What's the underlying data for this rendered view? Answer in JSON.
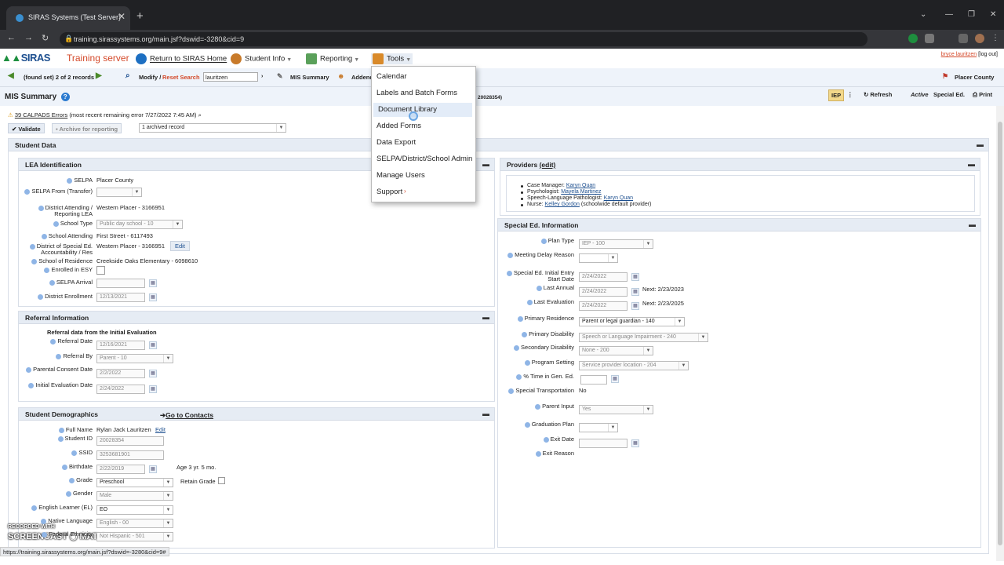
{
  "browser": {
    "tab_title": "SIRAS Systems (Test Server)",
    "url": "training.sirassystems.org/main.jsf?dswid=-3280&cid=9"
  },
  "app": {
    "logo": "SIRAS",
    "server": "Training server",
    "return_link": "Return to SIRAS Home",
    "nav": [
      "Student Info",
      "Reporting",
      "Tools"
    ],
    "user": "bryce lauritzen",
    "logout": "[log out]"
  },
  "toolbar": {
    "found_set": "(found set) 2 of 2 records",
    "modify": "Modify /",
    "reset": "Reset Search",
    "search_value": "lauritzen",
    "mis_summary": "MIS Summary",
    "addendum": "Addend",
    "student_id_short": "20028354)",
    "district": "Placer County"
  },
  "page": {
    "title": "MIS Summary",
    "iep": "IEP",
    "refresh": "Refresh",
    "active": "Active",
    "sped": "Special Ed.",
    "print": "Print"
  },
  "alerts": {
    "calpads": "39 CALPADS Errors",
    "calpads_note": "(most recent remaining error 7/27/2022 7:45 AM)",
    "validate": "Validate",
    "archive": "Archive for reporting",
    "archived": "1 archived record"
  },
  "student_data": {
    "header": "Student Data"
  },
  "lea": {
    "header": "LEA Identification",
    "rows": [
      {
        "label": "SELPA",
        "value": "Placer County"
      },
      {
        "label": "SELPA From (Transfer)",
        "value": ""
      },
      {
        "label": "District Attending / Reporting LEA",
        "value": "Western Placer - 3166951"
      },
      {
        "label": "School Type",
        "value": "Public day school - 10"
      },
      {
        "label": "School Attending",
        "value": "First Street - 6117493"
      },
      {
        "label": "District of Special Ed. Accountability / Res",
        "value": "Western Placer - 3166951",
        "action": "Edit"
      },
      {
        "label": "School of Residence",
        "value": "Creekside Oaks Elementary - 6098610"
      },
      {
        "label": "Enrolled in ESY",
        "value": ""
      },
      {
        "label": "SELPA Arrival",
        "value": ""
      },
      {
        "label": "District Enrollment",
        "value": "12/13/2021"
      }
    ]
  },
  "referral": {
    "header": "Referral Information",
    "subhead": "Referral data from the Initial Evaluation",
    "rows": [
      {
        "label": "Referral Date",
        "value": "12/16/2021"
      },
      {
        "label": "Referral By",
        "value": "Parent - 10"
      },
      {
        "label": "Parental Consent Date",
        "value": "2/2/2022"
      },
      {
        "label": "Initial Evaluation Date",
        "value": "2/24/2022"
      }
    ]
  },
  "demographics": {
    "header": "Student Demographics",
    "contacts_link": "Go to Contacts",
    "rows": [
      {
        "label": "Full Name",
        "value": "Rylan Jack Lauritzen",
        "action": "Edit"
      },
      {
        "label": "Student ID",
        "value": "20028354"
      },
      {
        "label": "SSID",
        "value": "3253681901"
      },
      {
        "label": "Birthdate",
        "value": "2/22/2019",
        "extra": "Age 3 yr. 5 mo."
      },
      {
        "label": "Grade",
        "value": "Preschool",
        "extra": "Retain Grade"
      },
      {
        "label": "Gender",
        "value": "Male"
      },
      {
        "label": "English Learner (EL)",
        "value": "EO"
      },
      {
        "label": "Native Language",
        "value": "English - 00"
      },
      {
        "label": "Federal Ethnicity",
        "value": "Not Hispanic - 501"
      }
    ]
  },
  "providers": {
    "header": "Providers",
    "edit": "(edit)",
    "items": [
      {
        "role": "Case Manager:",
        "name": "Karyn Quan",
        "note": ""
      },
      {
        "role": "Psychologist:",
        "name": "Mayela Martinez",
        "note": ""
      },
      {
        "role": "Speech-Language Pathologist:",
        "name": "Karyn Quan",
        "note": ""
      },
      {
        "role": "Nurse:",
        "name": "Kelley Gordon",
        "note": "(schoolwide default provider)"
      }
    ]
  },
  "sped": {
    "header": "Special Ed. Information",
    "rows": [
      {
        "label": "Plan Type",
        "value": "IEP - 100"
      },
      {
        "label": "Meeting Delay Reason",
        "value": ""
      },
      {
        "label": "Special Ed. Initial Entry Start Date",
        "value": "2/24/2022"
      },
      {
        "label": "Last Annual",
        "value": "2/24/2022",
        "extra": "Next: 2/23/2023"
      },
      {
        "label": "Last Evaluation",
        "value": "2/24/2022",
        "extra": "Next: 2/23/2025"
      },
      {
        "label": "Primary Residence",
        "value": "Parent or legal guardian - 140"
      },
      {
        "label": "Primary Disability",
        "value": "Speech or Language Impairment - 240"
      },
      {
        "label": "Secondary Disability",
        "value": "None - 200"
      },
      {
        "label": "Program Setting",
        "value": "Service provider location - 204"
      },
      {
        "label": "% Time in Gen. Ed.",
        "value": ""
      },
      {
        "label": "Special Transportation",
        "value": "No"
      },
      {
        "label": "Parent Input",
        "value": "Yes"
      },
      {
        "label": "Graduation Plan",
        "value": ""
      },
      {
        "label": "Exit Date",
        "value": ""
      },
      {
        "label": "Exit Reason",
        "value": ""
      }
    ]
  },
  "tools_menu": {
    "items": [
      "Calendar",
      "Labels and Batch Forms",
      "Document Library",
      "Added Forms",
      "Data Export",
      "SELPA/District/School Admin",
      "Manage Users",
      "Support"
    ],
    "highlighted": "Document Library"
  },
  "status_url": "https://training.sirassystems.org/main.jsf?dswid=-3280&cid=9#",
  "watermark": {
    "line1": "RECORDED WITH",
    "line2": "SCREENCAST",
    "line3": "MATIC"
  },
  "colors": {
    "accent": "#1d4f8f",
    "server_red": "#d4492a",
    "header_bg": "#e6ecf4"
  }
}
